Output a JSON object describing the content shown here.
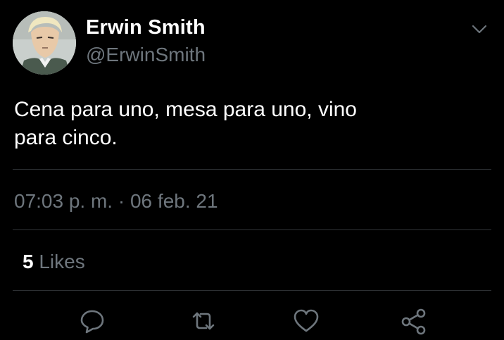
{
  "user": {
    "display_name": "Erwin Smith",
    "handle": "@ErwinSmith"
  },
  "tweet": {
    "text_line1": "Cena para uno, mesa para uno, vino",
    "text_line2": "para cinco.",
    "time": "07:03 p. m.",
    "separator": "·",
    "date": "06 feb. 21"
  },
  "stats": {
    "likes_count": "5",
    "likes_label": "Likes"
  },
  "icons": {
    "caret": "chevron-down-icon",
    "reply": "reply-icon",
    "retweet": "retweet-icon",
    "like": "heart-icon",
    "share": "share-icon"
  },
  "colors": {
    "background": "#000000",
    "primary_text": "#ffffff",
    "secondary_text": "#6e767d",
    "divider": "#2f3336"
  }
}
